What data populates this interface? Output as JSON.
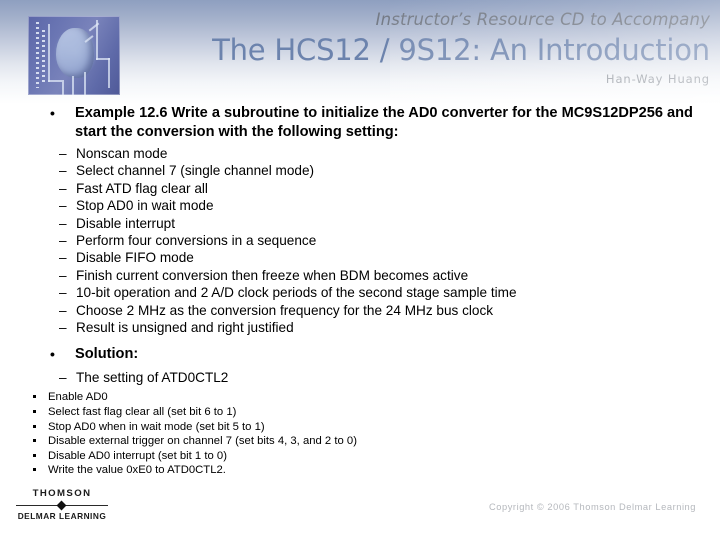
{
  "header": {
    "accompany": "Instructor’s Resource CD to Accompany",
    "title": "The HCS12 / 9S12: An Introduction",
    "author": "Han-Way Huang",
    "logo_icon": "cover-art-icon",
    "title_color": "#6c83ad",
    "gradient_top_color": "#8e9fc0",
    "gradient_bottom_color": "#ffffff"
  },
  "body": {
    "bullet_level1_marker": "•",
    "bullet_level2_marker": "–",
    "example": {
      "heading": "Example 12.6 Write a subroutine to initialize the AD0 converter for the MC9S12DP256 and start the conversion with the following setting:",
      "requirements": [
        "Nonscan mode",
        "Select channel 7 (single channel mode)",
        "Fast ATD flag clear all",
        "Stop AD0 in wait mode",
        "Disable interrupt",
        "Perform four conversions in a sequence",
        "Disable FIFO mode",
        "Finish current conversion then freeze when BDM becomes active",
        "10-bit operation and 2 A/D clock periods of the second stage sample time",
        "Choose 2 MHz as the conversion frequency for the 24 MHz bus clock",
        "Result is unsigned and right justified"
      ]
    },
    "solution": {
      "heading": "Solution:",
      "subheading": "The setting of ATD0CTL2",
      "steps": [
        "Enable AD0",
        "Select fast flag clear all (set bit 6 to 1)",
        "Stop AD0 when in wait mode (set bit 5 to 1)",
        "Disable external trigger on channel 7 (set bits 4, 3, and 2 to 0)",
        "Disable AD0 interrupt (set bit 1 to 0)",
        "Write the value 0xE0 to ATD0CTL2."
      ]
    }
  },
  "footer": {
    "brand_primary": "THOMSON",
    "brand_secondary": "DELMAR LEARNING",
    "copyright": "Copyright © 2006 Thomson Delmar Learning",
    "copyright_color": "#b5b8bd"
  }
}
